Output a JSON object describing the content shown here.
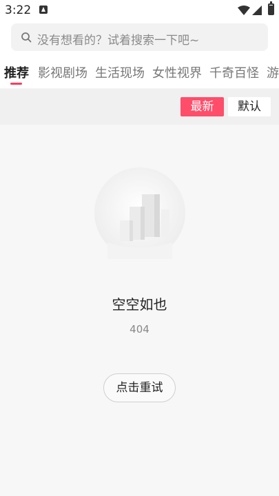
{
  "status_bar": {
    "time": "3:22",
    "icons": [
      "notification-icon",
      "wifi-icon",
      "signal-icon",
      "battery-icon"
    ]
  },
  "search": {
    "placeholder": "没有想看的？试着搜索一下吧~",
    "icon": "search-icon"
  },
  "tabs": [
    {
      "label": "推荐",
      "active": true
    },
    {
      "label": "影视剧场",
      "active": false
    },
    {
      "label": "生活现场",
      "active": false
    },
    {
      "label": "女性视界",
      "active": false
    },
    {
      "label": "千奇百怪",
      "active": false
    },
    {
      "label": "游",
      "active": false
    }
  ],
  "sort": {
    "latest_label": "最新",
    "default_label": "默认",
    "selected": "最新"
  },
  "empty_state": {
    "title": "空空如也",
    "code": "404",
    "retry_label": "点击重试",
    "illustration": "empty-city-illustration"
  },
  "colors": {
    "accent": "#ff4d6a",
    "tab_indicator": "#ff3b5c"
  }
}
